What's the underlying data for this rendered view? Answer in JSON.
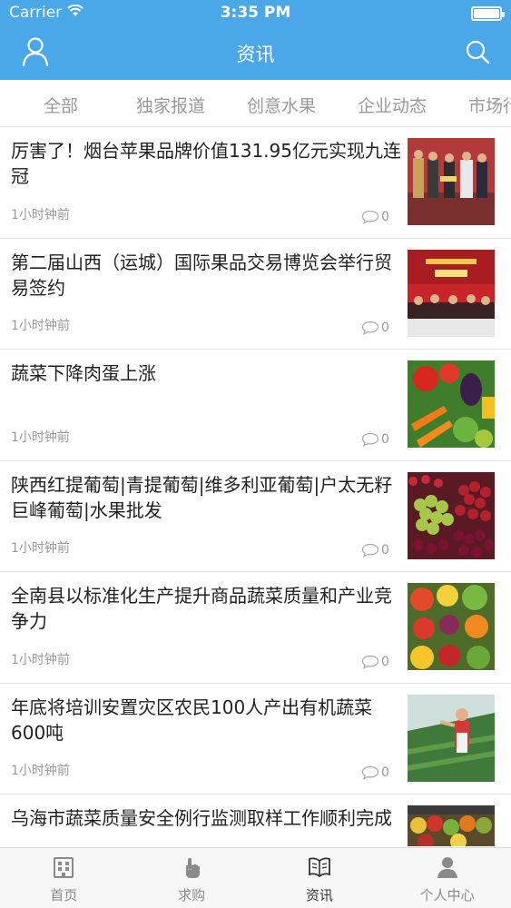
{
  "status": {
    "carrier": "Carrier",
    "time": "3:35 PM",
    "battery_level": 1.0
  },
  "header": {
    "title": "资讯"
  },
  "tabs": [
    {
      "label": "全部"
    },
    {
      "label": "独家报道"
    },
    {
      "label": "创意水果"
    },
    {
      "label": "企业动态"
    },
    {
      "label": "市场行"
    }
  ],
  "articles": [
    {
      "title": "厉害了！烟台苹果品牌价值131.95亿元实现九连冠",
      "time": "1小时钟前",
      "comments": "0",
      "image": "award-ceremony-photo"
    },
    {
      "title": "第二届山西（运城）国际果品交易博览会举行贸易签约",
      "time": "1小时钟前",
      "comments": "0",
      "image": "signing-ceremony-photo"
    },
    {
      "title": "蔬菜下降肉蛋上涨",
      "time": "1小时钟前",
      "comments": "0",
      "image": "vegetables-photo"
    },
    {
      "title": "陕西红提葡萄|青提葡萄|维多利亚葡萄|户太无籽巨峰葡萄|水果批发",
      "time": "1小时钟前",
      "comments": "0",
      "image": "grapes-photo"
    },
    {
      "title": "全南县以标准化生产提升商品蔬菜质量和产业竞争力",
      "time": "1小时钟前",
      "comments": "0",
      "image": "mixed-produce-photo"
    },
    {
      "title": "年底将培训安置灾区农民100人产出有机蔬菜600吨",
      "time": "1小时钟前",
      "comments": "0",
      "image": "greenhouse-farmer-photo"
    },
    {
      "title": "乌海市蔬菜质量安全例行监测取样工作顺利完成",
      "time": "",
      "comments": "",
      "image": "produce-stall-photo"
    }
  ],
  "tabbar": [
    {
      "label": "首页",
      "icon": "home-building-icon"
    },
    {
      "label": "求购",
      "icon": "hand-tap-icon"
    },
    {
      "label": "资讯",
      "icon": "open-book-icon"
    },
    {
      "label": "个人中心",
      "icon": "person-icon"
    }
  ],
  "colors": {
    "brand": "#4AA8E8",
    "text": "#222222",
    "muted": "#9A9A9A"
  }
}
